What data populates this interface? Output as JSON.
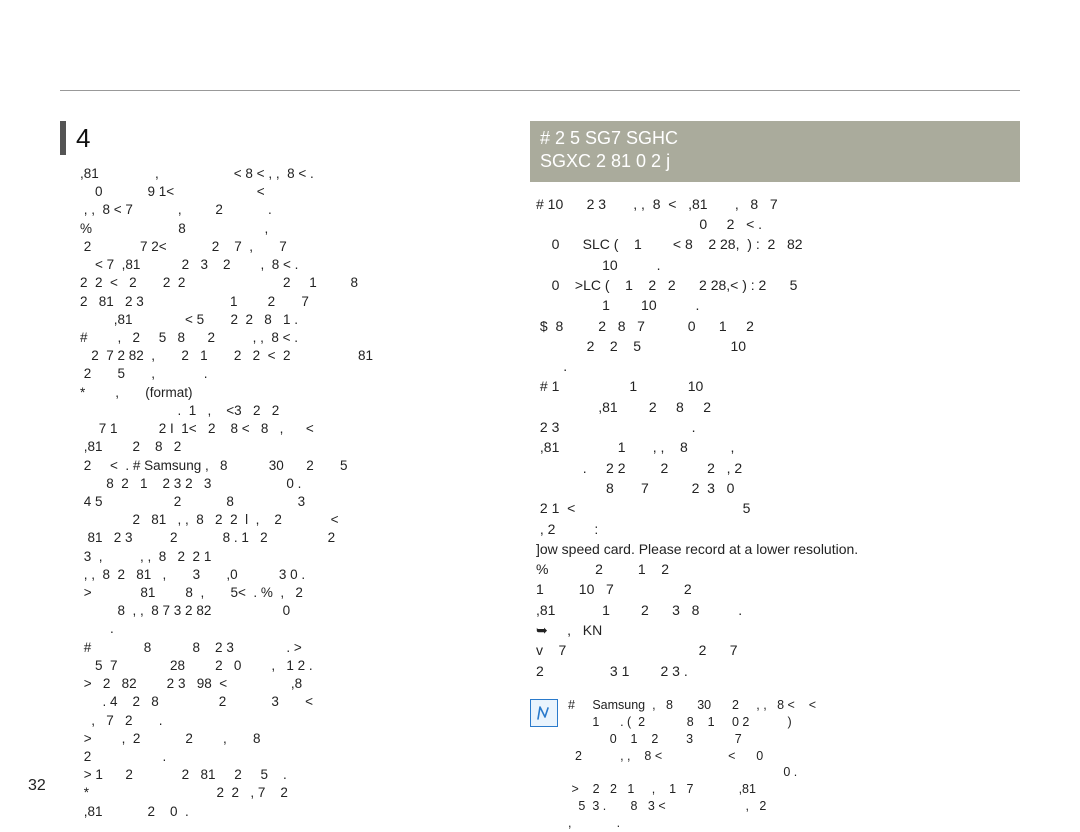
{
  "page_number": "32",
  "section": {
    "number": "4"
  },
  "left_column": {
    "body": ",81               ,                    < 8 < , ,  8 < .\n    0            9 1<                      <\n , ,  8 < 7            ,         2            .\n%                       8                     ,\n 2             7 2<            2    7  ,       7\n    < 7  ,81           2   3    2        ,  8 < .\n2  2  <   2       2  2                          2     1         8\n2   81   2 3                       1        2       7\n         ,81              < 5       2  2   8   1 .\n#        ,   2     5   8      2          , ,  8 < .\n   2  7 2 82  ,       2   1       2   2  <  2                  81\n 2       5       ,             .\n*        ,       (format)\n                          .  1   ,    <3   2   2\n     7 1           2 I  1<   2    8 <   8   ,      <\n ,81        2    8   2\n 2     <  . # Samsung ,   8           30      2       5\n       8  2   1    2 3 2   3                    0 .\n 4 5                   2            8                 3\n              2   81   , ,  8   2  2  l  ,    2             <\n  81   2 3          2            8 . 1   2                2\n 3  ,          , ,  8   2  2 1\n , ,  8  2   81   ,       3       ,0           3 0 .\n >             81        8  ,       5<  . %  ,   2\n          8  , ,  8 7 3 2 82                   0\n        .\n #              8           8    2 3              . >\n    5  7              28        2   0        ,   1 2 .\n >   2   82        2 3   98  <                 ,8\n      . 4    2   8                2            3       <\n   ,   7   2       .\n >        ,  2            2        ,       8\n 2                   .\n > 1      2             2   81     2     5    .\n *                                  2  2   , 7    2\n ,81            2    0  ."
  },
  "right_column": {
    "header_line1": "#            2     5           SG7 SGHC",
    "header_line2": "SGXC 2  81            0     2         j",
    "body": "# 10      2 3       , ,  8  <   ,81       ,   8   7\n                                          0     2   < .\n    0      SLC (    1        < 8    2 28,  ) :  2   82\n                 10          .\n    0    >LC (    1    2   2      2 28,< ) : 2      5\n                 1        10          .\n $  8         2   8   7           0      1     2\n             2    2    5                       10\n       .\n # 1                  1             10\n                ,81        2     8     2\n 2 3                                  .\n ,81               1       , ,    8           ,\n            .     2 2         2          2   , 2\n                  8       7           2  3   0\n 2 1  <                                           5\n , 2          :\n]ow speed card. Please record at a lower resolution.\n%            2         1    2\n1         10   7                  2\n,81            1        2      3   8          .\n➥     ,   KN\nv    7                                  2      7\n2                 3 1        2 3 ."
  },
  "note": {
    "text": "#     Samsung  ,   8       30      2     , ,   8 <    <\n       1      . (  2            8    1     0 2           )\n            0    1    2        3            7\n  2           , ,    8 <                   <      0\n                                                              0 .\n >    2   2   1     ,    1   7             ,81\n   5  3 .       8   3 <                       ,   2\n,             ."
  }
}
